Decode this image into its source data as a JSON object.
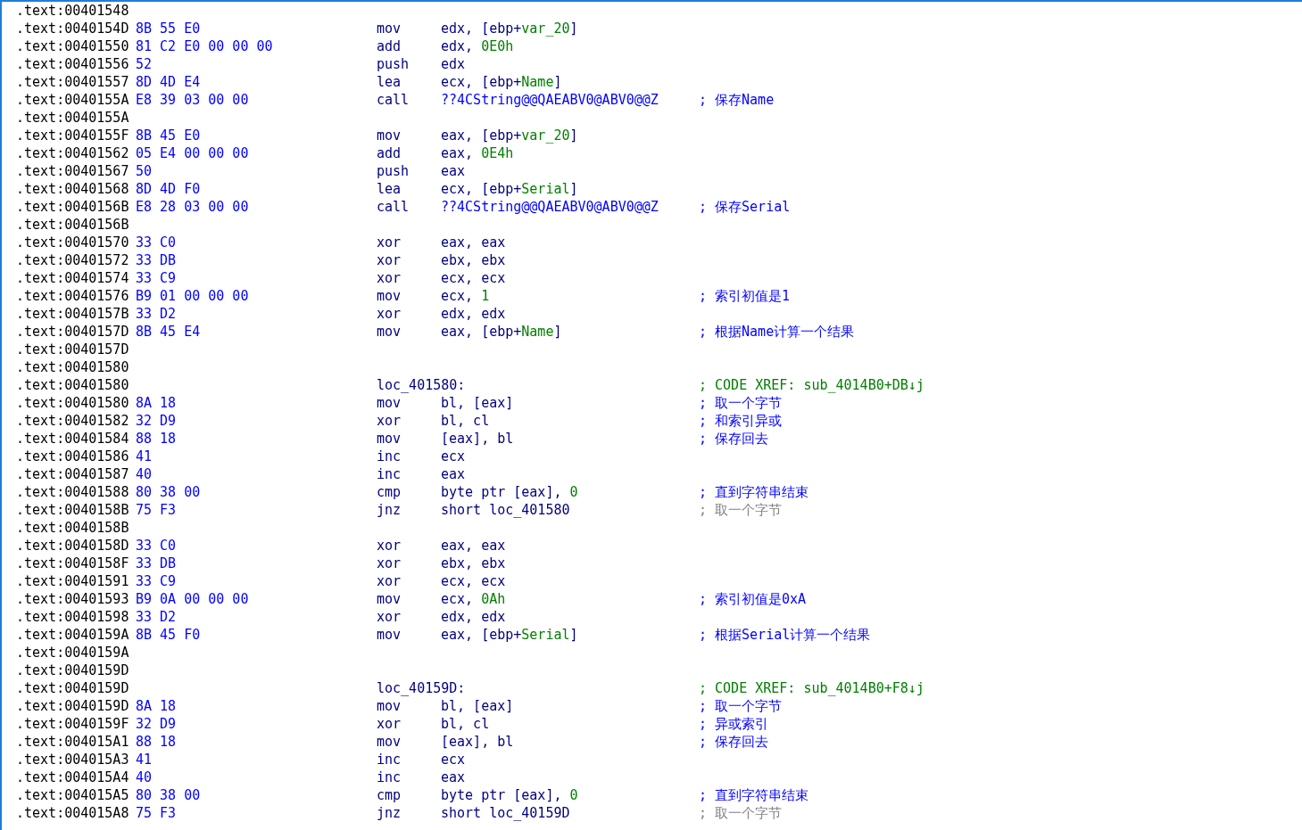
{
  "listing": {
    "lines": [
      {
        "address": ".text:00401548"
      },
      {
        "address": ".text:0040154D",
        "bytes": "8B 55 E0",
        "mnemonic": "mov",
        "operands": [
          {
            "text": "edx, [ebp+",
            "kind": "plain"
          },
          {
            "text": "var_20",
            "kind": "var"
          },
          {
            "text": "]",
            "kind": "plain"
          }
        ]
      },
      {
        "address": ".text:00401550",
        "bytes": "81 C2 E0 00 00 00",
        "mnemonic": "add",
        "operands": [
          {
            "text": "edx, ",
            "kind": "plain"
          },
          {
            "text": "0E0h",
            "kind": "number"
          }
        ]
      },
      {
        "address": ".text:00401556",
        "bytes": "52",
        "mnemonic": "push",
        "operands": [
          {
            "text": "edx",
            "kind": "plain"
          }
        ]
      },
      {
        "address": ".text:00401557",
        "bytes": "8D 4D E4",
        "mnemonic": "lea",
        "operands": [
          {
            "text": "ecx, [ebp+",
            "kind": "plain"
          },
          {
            "text": "Name",
            "kind": "var"
          },
          {
            "text": "]",
            "kind": "plain"
          }
        ]
      },
      {
        "address": ".text:0040155A",
        "bytes": "E8 39 03 00 00",
        "mnemonic": "call",
        "operands": [
          {
            "text": "??4CString@@QAEABV0@ABV0@@Z",
            "kind": "func"
          }
        ],
        "comment": {
          "text": "; 保存Name",
          "kind": "user"
        }
      },
      {
        "address": ".text:0040155A"
      },
      {
        "address": ".text:0040155F",
        "bytes": "8B 45 E0",
        "mnemonic": "mov",
        "operands": [
          {
            "text": "eax, [ebp+",
            "kind": "plain"
          },
          {
            "text": "var_20",
            "kind": "var"
          },
          {
            "text": "]",
            "kind": "plain"
          }
        ]
      },
      {
        "address": ".text:00401562",
        "bytes": "05 E4 00 00 00",
        "mnemonic": "add",
        "operands": [
          {
            "text": "eax, ",
            "kind": "plain"
          },
          {
            "text": "0E4h",
            "kind": "number"
          }
        ]
      },
      {
        "address": ".text:00401567",
        "bytes": "50",
        "mnemonic": "push",
        "operands": [
          {
            "text": "eax",
            "kind": "plain"
          }
        ]
      },
      {
        "address": ".text:00401568",
        "bytes": "8D 4D F0",
        "mnemonic": "lea",
        "operands": [
          {
            "text": "ecx, [ebp+",
            "kind": "plain"
          },
          {
            "text": "Serial",
            "kind": "var"
          },
          {
            "text": "]",
            "kind": "plain"
          }
        ]
      },
      {
        "address": ".text:0040156B",
        "bytes": "E8 28 03 00 00",
        "mnemonic": "call",
        "operands": [
          {
            "text": "??4CString@@QAEABV0@ABV0@@Z",
            "kind": "func"
          }
        ],
        "comment": {
          "text": "; 保存Serial",
          "kind": "user"
        }
      },
      {
        "address": ".text:0040156B"
      },
      {
        "address": ".text:00401570",
        "bytes": "33 C0",
        "mnemonic": "xor",
        "operands": [
          {
            "text": "eax, eax",
            "kind": "plain"
          }
        ]
      },
      {
        "address": ".text:00401572",
        "bytes": "33 DB",
        "mnemonic": "xor",
        "operands": [
          {
            "text": "ebx, ebx",
            "kind": "plain"
          }
        ]
      },
      {
        "address": ".text:00401574",
        "bytes": "33 C9",
        "mnemonic": "xor",
        "operands": [
          {
            "text": "ecx, ecx",
            "kind": "plain"
          }
        ]
      },
      {
        "address": ".text:00401576",
        "bytes": "B9 01 00 00 00",
        "mnemonic": "mov",
        "operands": [
          {
            "text": "ecx, ",
            "kind": "plain"
          },
          {
            "text": "1",
            "kind": "number"
          }
        ],
        "comment": {
          "text": "; 索引初值是1",
          "kind": "user"
        }
      },
      {
        "address": ".text:0040157B",
        "bytes": "33 D2",
        "mnemonic": "xor",
        "operands": [
          {
            "text": "edx, edx",
            "kind": "plain"
          }
        ]
      },
      {
        "address": ".text:0040157D",
        "bytes": "8B 45 E4",
        "mnemonic": "mov",
        "operands": [
          {
            "text": "eax, [ebp+",
            "kind": "plain"
          },
          {
            "text": "Name",
            "kind": "var"
          },
          {
            "text": "]",
            "kind": "plain"
          }
        ],
        "comment": {
          "text": "; 根据Name计算一个结果",
          "kind": "user"
        }
      },
      {
        "address": ".text:0040157D"
      },
      {
        "address": ".text:00401580"
      },
      {
        "address": ".text:00401580",
        "label": "loc_401580:",
        "comment": {
          "text": "; CODE XREF: sub_4014B0+DB↓j",
          "kind": "xref"
        }
      },
      {
        "address": ".text:00401580",
        "bytes": "8A 18",
        "mnemonic": "mov",
        "operands": [
          {
            "text": "bl, [eax]",
            "kind": "plain"
          }
        ],
        "comment": {
          "text": "; 取一个字节",
          "kind": "user"
        }
      },
      {
        "address": ".text:00401582",
        "bytes": "32 D9",
        "mnemonic": "xor",
        "operands": [
          {
            "text": "bl, cl",
            "kind": "plain"
          }
        ],
        "comment": {
          "text": "; 和索引异或",
          "kind": "user"
        }
      },
      {
        "address": ".text:00401584",
        "bytes": "88 18",
        "mnemonic": "mov",
        "operands": [
          {
            "text": "[eax], bl",
            "kind": "plain"
          }
        ],
        "comment": {
          "text": "; 保存回去",
          "kind": "user"
        }
      },
      {
        "address": ".text:00401586",
        "bytes": "41",
        "mnemonic": "inc",
        "operands": [
          {
            "text": "ecx",
            "kind": "plain"
          }
        ]
      },
      {
        "address": ".text:00401587",
        "bytes": "40",
        "mnemonic": "inc",
        "operands": [
          {
            "text": "eax",
            "kind": "plain"
          }
        ]
      },
      {
        "address": ".text:00401588",
        "bytes": "80 38 00",
        "mnemonic": "cmp",
        "operands": [
          {
            "text": "byte ptr [eax], ",
            "kind": "plain"
          },
          {
            "text": "0",
            "kind": "number"
          }
        ],
        "comment": {
          "text": "; 直到字符串结束",
          "kind": "user"
        }
      },
      {
        "address": ".text:0040158B",
        "bytes": "75 F3",
        "mnemonic": "jnz",
        "operands": [
          {
            "text": "short loc_401580",
            "kind": "plain"
          }
        ],
        "comment": {
          "text": "; 取一个字节",
          "kind": "repeat"
        }
      },
      {
        "address": ".text:0040158B"
      },
      {
        "address": ".text:0040158D",
        "bytes": "33 C0",
        "mnemonic": "xor",
        "operands": [
          {
            "text": "eax, eax",
            "kind": "plain"
          }
        ]
      },
      {
        "address": ".text:0040158F",
        "bytes": "33 DB",
        "mnemonic": "xor",
        "operands": [
          {
            "text": "ebx, ebx",
            "kind": "plain"
          }
        ]
      },
      {
        "address": ".text:00401591",
        "bytes": "33 C9",
        "mnemonic": "xor",
        "operands": [
          {
            "text": "ecx, ecx",
            "kind": "plain"
          }
        ]
      },
      {
        "address": ".text:00401593",
        "bytes": "B9 0A 00 00 00",
        "mnemonic": "mov",
        "operands": [
          {
            "text": "ecx, ",
            "kind": "plain"
          },
          {
            "text": "0Ah",
            "kind": "number"
          }
        ],
        "comment": {
          "text": "; 索引初值是0xA",
          "kind": "user"
        }
      },
      {
        "address": ".text:00401598",
        "bytes": "33 D2",
        "mnemonic": "xor",
        "operands": [
          {
            "text": "edx, edx",
            "kind": "plain"
          }
        ]
      },
      {
        "address": ".text:0040159A",
        "bytes": "8B 45 F0",
        "mnemonic": "mov",
        "operands": [
          {
            "text": "eax, [ebp+",
            "kind": "plain"
          },
          {
            "text": "Serial",
            "kind": "var"
          },
          {
            "text": "]",
            "kind": "plain"
          }
        ],
        "comment": {
          "text": "; 根据Serial计算一个结果",
          "kind": "user"
        }
      },
      {
        "address": ".text:0040159A"
      },
      {
        "address": ".text:0040159D"
      },
      {
        "address": ".text:0040159D",
        "label": "loc_40159D:",
        "comment": {
          "text": "; CODE XREF: sub_4014B0+F8↓j",
          "kind": "xref"
        }
      },
      {
        "address": ".text:0040159D",
        "bytes": "8A 18",
        "mnemonic": "mov",
        "operands": [
          {
            "text": "bl, [eax]",
            "kind": "plain"
          }
        ],
        "comment": {
          "text": "; 取一个字节",
          "kind": "user"
        }
      },
      {
        "address": ".text:0040159F",
        "bytes": "32 D9",
        "mnemonic": "xor",
        "operands": [
          {
            "text": "bl, cl",
            "kind": "plain"
          }
        ],
        "comment": {
          "text": "; 异或索引",
          "kind": "user"
        }
      },
      {
        "address": ".text:004015A1",
        "bytes": "88 18",
        "mnemonic": "mov",
        "operands": [
          {
            "text": "[eax], bl",
            "kind": "plain"
          }
        ],
        "comment": {
          "text": "; 保存回去",
          "kind": "user"
        }
      },
      {
        "address": ".text:004015A3",
        "bytes": "41",
        "mnemonic": "inc",
        "operands": [
          {
            "text": "ecx",
            "kind": "plain"
          }
        ]
      },
      {
        "address": ".text:004015A4",
        "bytes": "40",
        "mnemonic": "inc",
        "operands": [
          {
            "text": "eax",
            "kind": "plain"
          }
        ]
      },
      {
        "address": ".text:004015A5",
        "bytes": "80 38 00",
        "mnemonic": "cmp",
        "operands": [
          {
            "text": "byte ptr [eax], ",
            "kind": "plain"
          },
          {
            "text": "0",
            "kind": "number"
          }
        ],
        "comment": {
          "text": "; 直到字符串结束",
          "kind": "user"
        }
      },
      {
        "address": ".text:004015A8",
        "bytes": "75 F3",
        "mnemonic": "jnz",
        "operands": [
          {
            "text": "short loc_40159D",
            "kind": "plain"
          }
        ],
        "comment": {
          "text": "; 取一个字节",
          "kind": "repeat"
        }
      }
    ]
  }
}
